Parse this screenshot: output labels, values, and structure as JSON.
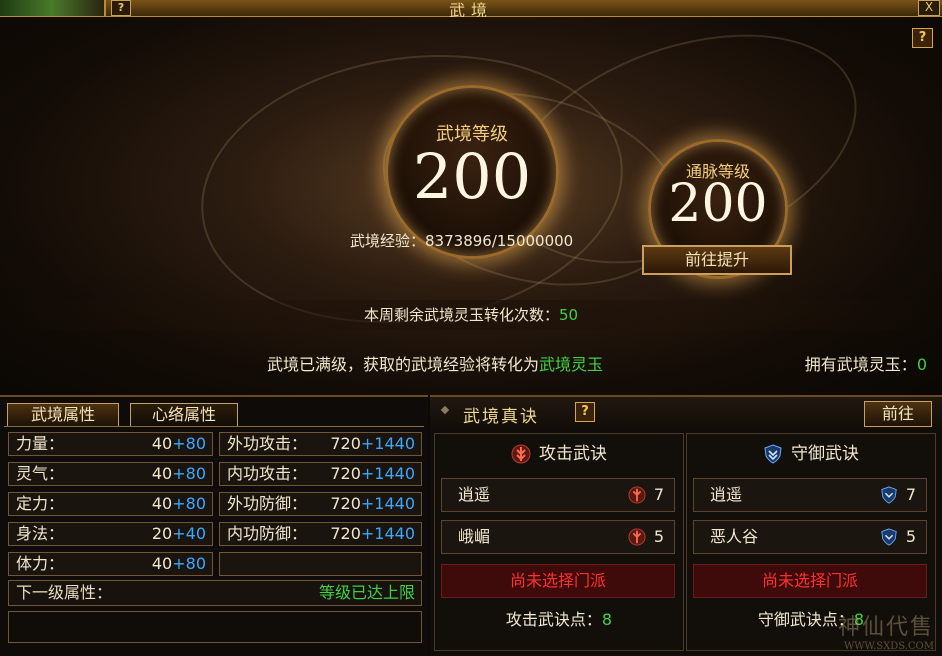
{
  "window": {
    "title": "武境",
    "help": "?",
    "close": "X"
  },
  "hero": {
    "help": "?",
    "wujing_level_label": "武境等级",
    "wujing_level": "200",
    "tongmai_level_label": "通脉等级",
    "tongmai_level": "200",
    "exp_label": "武境经验：",
    "exp_value": "8373896/15000000",
    "go_upgrade_label": "前往提升",
    "weekly_label": "本周剩余武境灵玉转化次数：",
    "weekly_count": "50",
    "maxed_msg": "武境已满级，获取的武境经验将转化为",
    "maxed_item": "武境灵玉",
    "own_label": "拥有武境灵玉：",
    "own_count": "0"
  },
  "attributes": {
    "tabs": [
      "武境属性",
      "心络属性"
    ],
    "left": [
      {
        "name": "力量：",
        "base": "40",
        "bonus": "+80"
      },
      {
        "name": "灵气：",
        "base": "40",
        "bonus": "+80"
      },
      {
        "name": "定力：",
        "base": "40",
        "bonus": "+80"
      },
      {
        "name": "身法：",
        "base": "20",
        "bonus": "+40"
      },
      {
        "name": "体力：",
        "base": "40",
        "bonus": "+80"
      }
    ],
    "right": [
      {
        "name": "外功攻击：",
        "base": "720",
        "bonus": "+1440"
      },
      {
        "name": "内功攻击：",
        "base": "720",
        "bonus": "+1440"
      },
      {
        "name": "外功防御：",
        "base": "720",
        "bonus": "+1440"
      },
      {
        "name": "内功防御：",
        "base": "720",
        "bonus": "+1440"
      }
    ],
    "next_label": "下一级属性：",
    "next_value": "等级已达上限"
  },
  "secrets": {
    "title": "武境真诀",
    "help": "?",
    "goto_label": "前往",
    "attack": {
      "title": "攻击武诀",
      "icon": "attack-emblem-icon",
      "skills": [
        {
          "name": "逍遥",
          "level": "7"
        },
        {
          "name": "峨嵋",
          "level": "5"
        }
      ],
      "unselected": "尚未选择门派",
      "points_label": "攻击武诀点：",
      "points": "8"
    },
    "defense": {
      "title": "守御武诀",
      "icon": "defense-shield-icon",
      "skills": [
        {
          "name": "逍遥",
          "level": "7"
        },
        {
          "name": "恶人谷",
          "level": "5"
        }
      ],
      "unselected": "尚未选择门派",
      "points_label": "守御武诀点：",
      "points": "8"
    }
  },
  "watermark": {
    "text": "神仙代售",
    "url": "WWW.SXDS.COM"
  },
  "colors": {
    "accent": "#c9a060",
    "green": "#3fd145",
    "blue": "#3aa8ff",
    "red": "#ff3030"
  }
}
